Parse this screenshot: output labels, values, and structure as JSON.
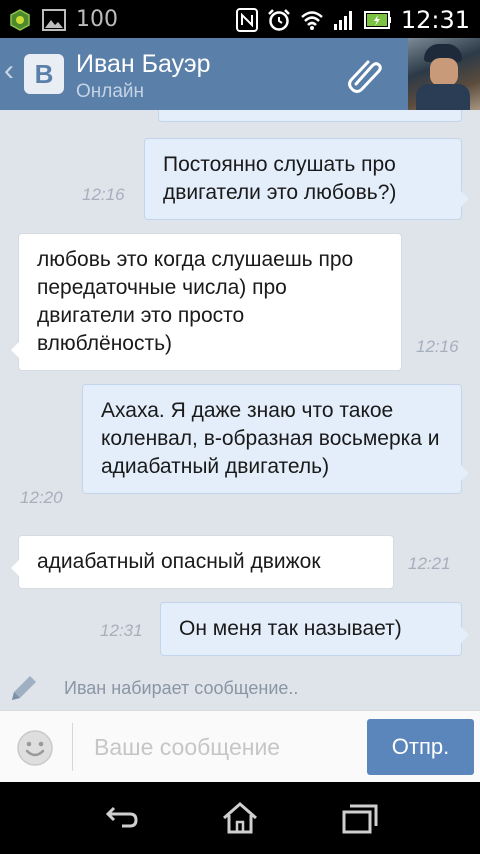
{
  "status_bar": {
    "notification_count": "100",
    "time": "12:31",
    "icons": [
      "game-notification-icon",
      "image-notification-icon",
      "nfc-icon",
      "alarm-icon",
      "wifi-icon",
      "signal-icon",
      "battery-icon"
    ]
  },
  "header": {
    "contact_name": "Иван Бауэр",
    "contact_status": "Онлайн",
    "logo_text": "B",
    "back_glyph": "‹",
    "colors": {
      "bar": "#5a7fa9",
      "status": "#c4d3e6"
    }
  },
  "messages": [
    {
      "direction": "out",
      "text": "Постоянно слушать про двигатели это любовь?)",
      "time": "12:16"
    },
    {
      "direction": "in",
      "text": "любовь это когда слушаешь про передаточные числа) про двигатели это просто влюблёность)",
      "time": "12:16"
    },
    {
      "direction": "out",
      "text": "Ахаха. Я даже знаю что такое коленвал, в-образная восьмерка и адиабатный двигатель)",
      "time": "12:20"
    },
    {
      "direction": "in",
      "text": "адиабатный опасный движок",
      "time": "12:21"
    },
    {
      "direction": "out",
      "text": "Он меня так называет)",
      "time": "12:31"
    }
  ],
  "typing_indicator": "Иван набирает сообщение..",
  "composer": {
    "placeholder": "Ваше сообщение",
    "send_label": "Отпр.",
    "colors": {
      "send": "#5b86bb"
    }
  },
  "navbar": {
    "icons": [
      "back-icon",
      "home-icon",
      "recent-apps-icon"
    ]
  }
}
